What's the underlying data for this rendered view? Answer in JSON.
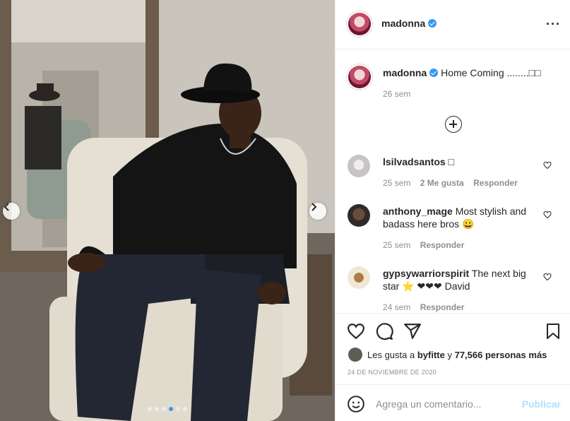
{
  "post": {
    "author": "madonna",
    "caption": "Home Coming ........□□",
    "caption_time": "26 sem",
    "likes_prefix": "Les gusta a",
    "likes_user": "byfitte",
    "likes_middle": "y",
    "likes_count": "77,566 personas más",
    "date": "24 DE NOVIEMBRE DE 2020",
    "carousel_count": 6,
    "carousel_active": 3
  },
  "comments": [
    {
      "user": "lsilvadsantos",
      "text": "□",
      "time": "25 sem",
      "likes": "2 Me gusta",
      "reply": "Responder"
    },
    {
      "user": "anthony_mage",
      "text": "Most stylish and badass here bros 😀",
      "time": "25 sem",
      "reply": "Responder"
    },
    {
      "user": "gypsywarriorspirit",
      "text": "The next big star ⭐ ❤❤❤ David",
      "time": "24 sem",
      "reply": "Responder"
    }
  ],
  "compose": {
    "placeholder": "Agrega un comentario...",
    "publish_label": "Publicar"
  },
  "icons": {
    "more": "more-options-icon",
    "verified": "verified-badge-icon",
    "like": "heart-icon",
    "comment": "comment-icon",
    "share": "share-icon",
    "save": "bookmark-icon",
    "emoji": "emoji-icon",
    "load_more": "plus-circle-icon"
  },
  "colors": {
    "accent": "#3897f0",
    "publish_disabled": "#b2dffc",
    "muted": "#8e8e8e"
  }
}
